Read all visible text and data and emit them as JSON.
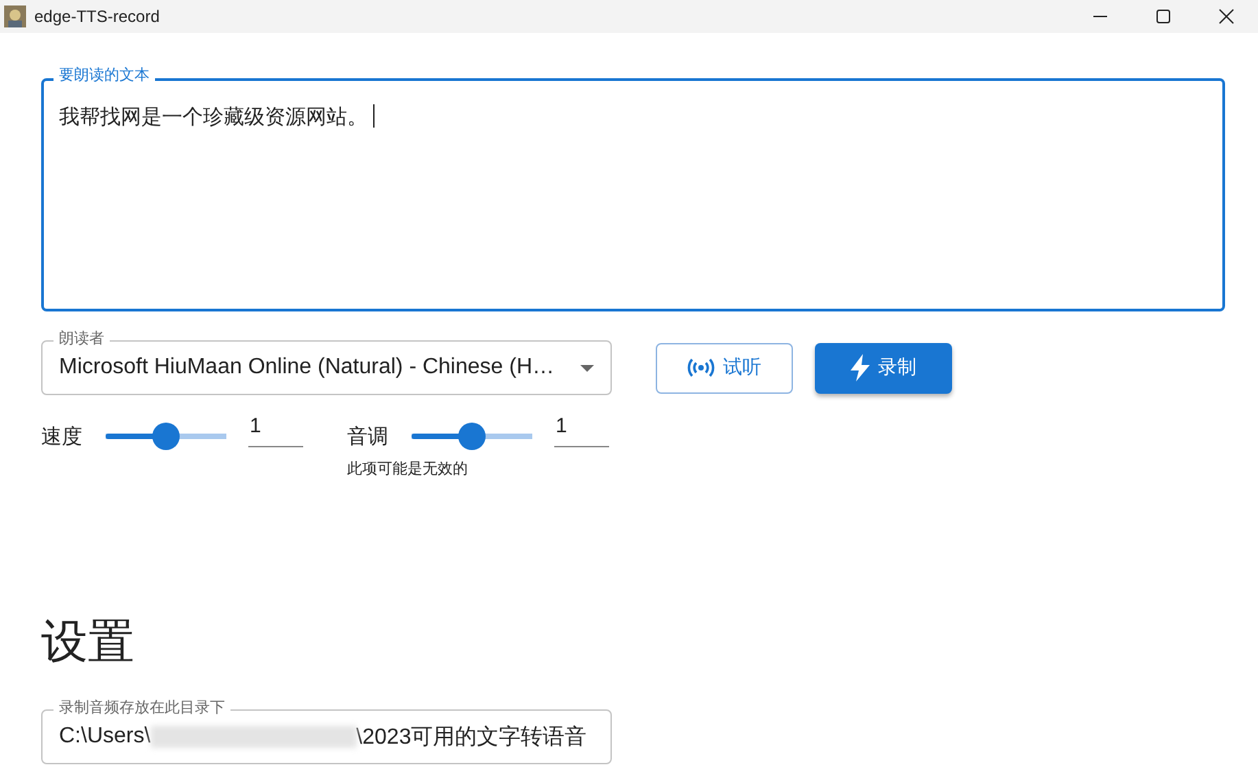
{
  "window": {
    "title": "edge-TTS-record"
  },
  "text_input": {
    "label": "要朗读的文本",
    "value": "我帮找网是一个珍藏级资源网站。",
    "focused": true
  },
  "voice_select": {
    "label": "朗读者",
    "value": "Microsoft HiuMaan Online (Natural) - Chinese (H…"
  },
  "buttons": [
    {
      "kind": "outlined",
      "label": "试听"
    },
    {
      "kind": "contained",
      "label": "录制"
    }
  ],
  "sliders": [
    {
      "label": "速度",
      "level": 0.5,
      "value": "1"
    },
    {
      "label": "音调",
      "level": 0.5,
      "value": "1",
      "helper": "此项可能是无效的"
    }
  ],
  "settings": {
    "heading": "设置",
    "output_dir": {
      "label": "录制音频存放在此目录下",
      "value_start": "C:\\Users\\",
      "value_end": "\\2023可用的文字转语音",
      "redacted": true
    }
  }
}
